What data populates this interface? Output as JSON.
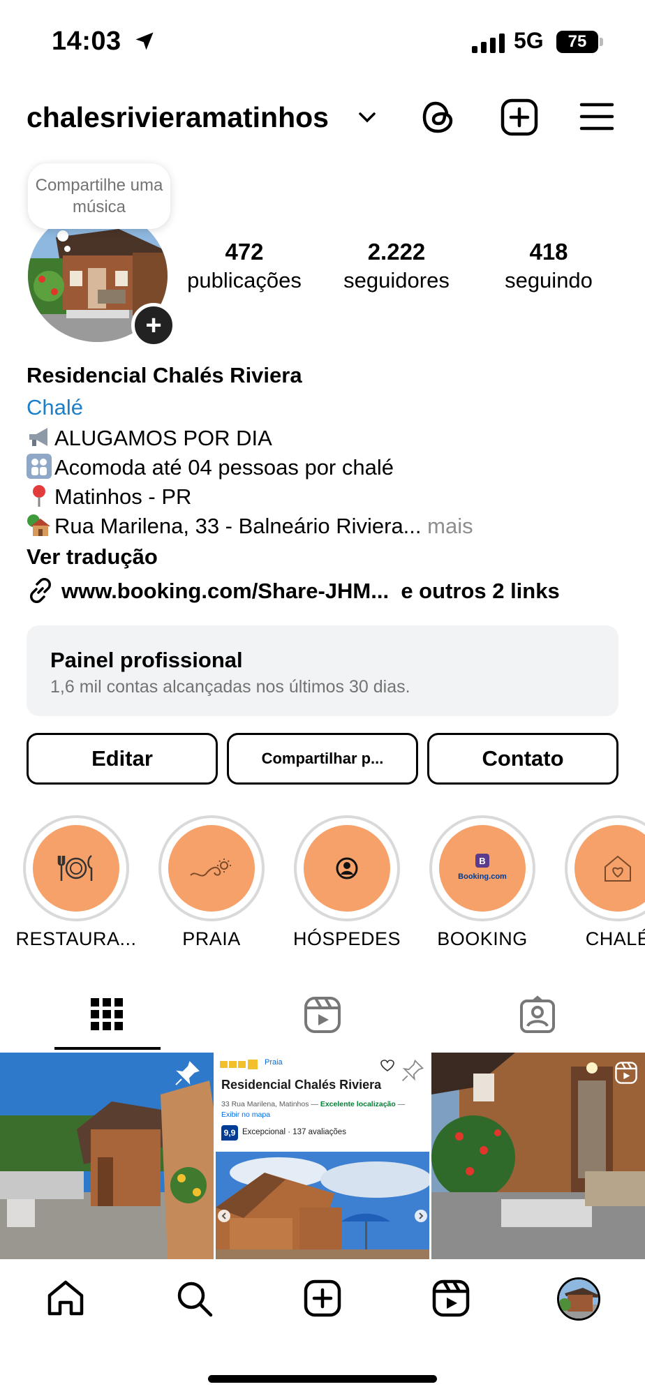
{
  "status_bar": {
    "time": "14:03",
    "network": "5G",
    "battery": "75"
  },
  "header": {
    "username": "chalesrivieramatinhos"
  },
  "profile": {
    "note_text": "Compartilhe uma música",
    "stats": [
      {
        "value": "472",
        "label": "publicações"
      },
      {
        "value": "2.222",
        "label": "seguidores"
      },
      {
        "value": "418",
        "label": "seguindo"
      }
    ],
    "name": "Residencial Chalés Riviera",
    "category": "Chalé",
    "bio_lines": [
      {
        "icon": "megaphone-icon",
        "text": "ALUGAMOS POR DIA"
      },
      {
        "icon": "family-icon",
        "text": "Acomoda até 04 pessoas por chalé"
      },
      {
        "icon": "pin-icon",
        "text": "Matinhos - PR"
      },
      {
        "icon": "house-icon",
        "text": "Rua Marilena, 33 - Balneário Riviera..."
      }
    ],
    "more_label": "mais",
    "translate_label": "Ver tradução",
    "link_text": "www.booking.com/Share-JHM...",
    "other_links": "e outros 2 links"
  },
  "pro_panel": {
    "title": "Painel profissional",
    "subtitle": "1,6 mil contas alcançadas nos últimos 30 dias."
  },
  "buttons": {
    "edit": "Editar",
    "share": "Compartilhar p...",
    "contact": "Contato"
  },
  "highlights": [
    {
      "label": "RESTAURA...",
      "icon": "plate-icon"
    },
    {
      "label": "PRAIA",
      "icon": "wave-sun-icon"
    },
    {
      "label": "HÓSPEDES",
      "icon": "person-icon"
    },
    {
      "label": "BOOKING",
      "icon": "booking-logo"
    },
    {
      "label": "CHALÉ",
      "icon": "heart-house-icon"
    }
  ],
  "post_card": {
    "tag": "Praia",
    "title": "Residencial Chalés Riviera",
    "address": "33 Rua Marilena, Matinhos —",
    "location_badge": "Excelente localização",
    "map_link": "Exibir no mapa",
    "score": "9,9",
    "rating_text": "Excepcional · 137 avaliações"
  },
  "colors": {
    "accent_link": "#1d7fc8",
    "highlight_fill": "#f6a169",
    "panel_bg": "#f2f3f5",
    "booking_blue": "#003b95"
  }
}
